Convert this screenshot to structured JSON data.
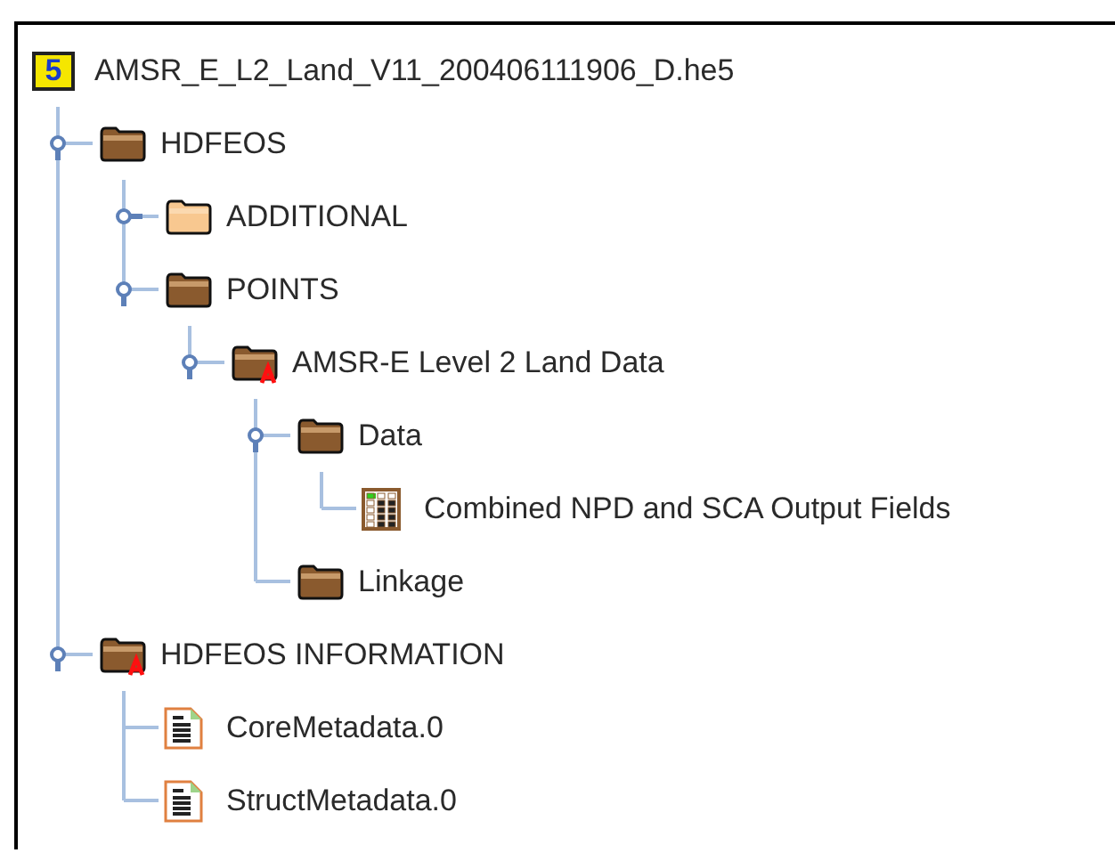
{
  "tree": {
    "kind": "file",
    "badge": "5",
    "label": "AMSR_E_L2_Land_V11_200406111906_D.he5",
    "children": [
      {
        "kind": "group",
        "label": "HDFEOS",
        "expanded": true,
        "attributes": false,
        "children": [
          {
            "kind": "group",
            "label": "ADDITIONAL",
            "expanded": false,
            "attributes": false
          },
          {
            "kind": "group",
            "label": "POINTS",
            "expanded": true,
            "attributes": false,
            "children": [
              {
                "kind": "group",
                "label": "AMSR-E Level 2 Land Data",
                "expanded": true,
                "attributes": true,
                "children": [
                  {
                    "kind": "group",
                    "label": "Data",
                    "expanded": true,
                    "attributes": false,
                    "children": [
                      {
                        "kind": "table",
                        "label": "Combined NPD and SCA Output Fields"
                      }
                    ]
                  },
                  {
                    "kind": "group",
                    "label": "Linkage",
                    "attributes": false
                  }
                ]
              }
            ]
          }
        ]
      },
      {
        "kind": "group",
        "label": "HDFEOS INFORMATION",
        "expanded": true,
        "attributes": true,
        "children": [
          {
            "kind": "text",
            "label": "CoreMetadata.0"
          },
          {
            "kind": "text",
            "label": "StructMetadata.0"
          }
        ]
      }
    ]
  }
}
